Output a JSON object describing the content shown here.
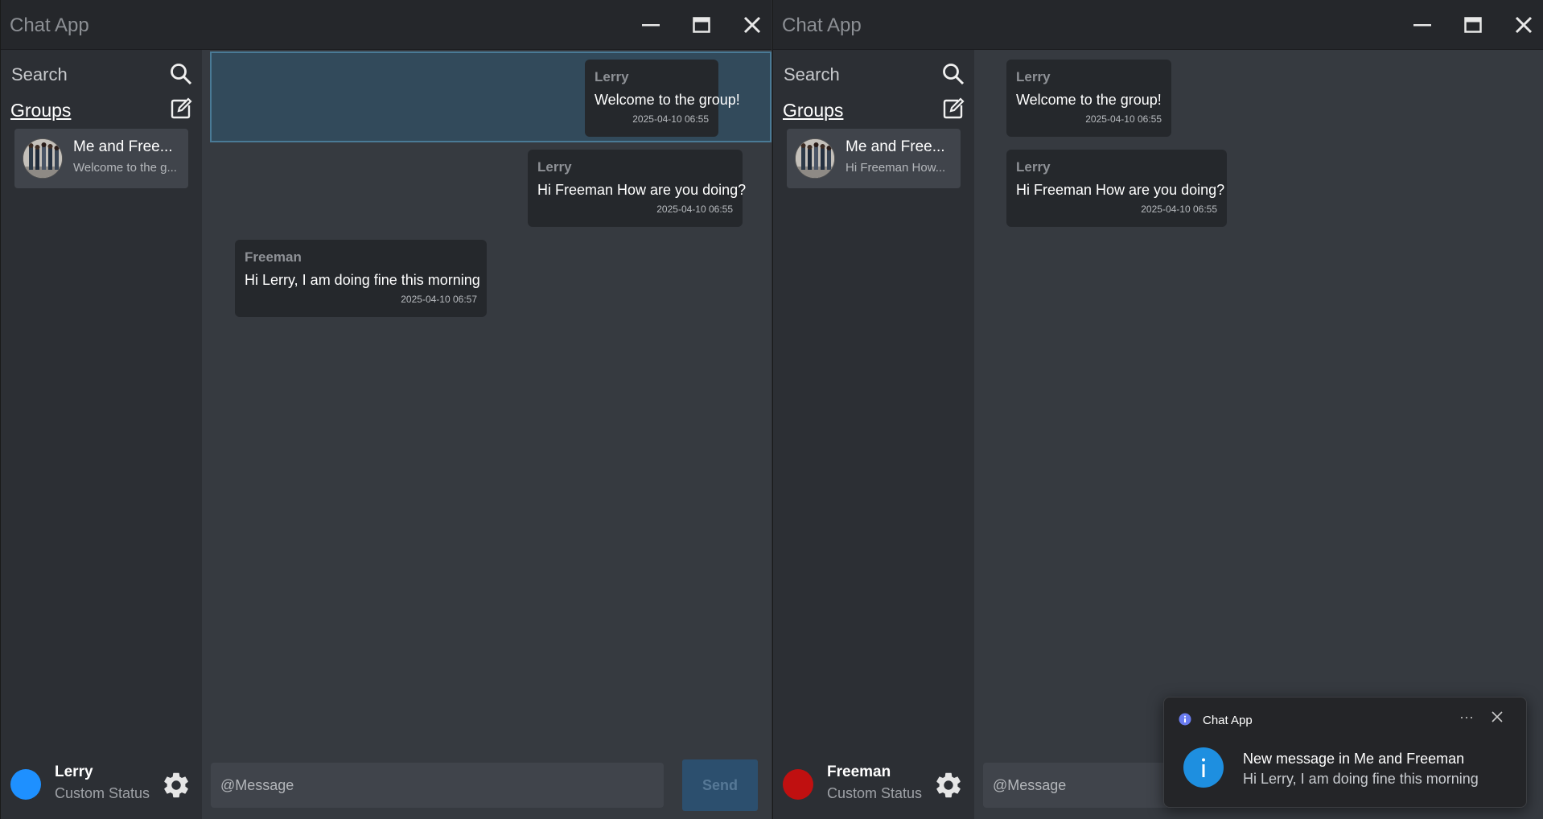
{
  "left_window": {
    "title": "Chat App",
    "sidebar": {
      "search_label": "Search",
      "groups_label": "Groups",
      "group": {
        "name": "Me and Free...",
        "preview": "Welcome to the g..."
      }
    },
    "messages": [
      {
        "sender": "Lerry",
        "text": "Welcome to the group!",
        "time": "2025-04-10 06:55"
      },
      {
        "sender": "Lerry",
        "text": "Hi Freeman How are you doing?",
        "time": "2025-04-10 06:55"
      },
      {
        "sender": "Freeman",
        "text": "Hi Lerry, I am doing fine this morning",
        "time": "2025-04-10 06:57"
      }
    ],
    "user": {
      "name": "Lerry",
      "status": "Custom Status",
      "status_color": "#1e90ff"
    },
    "composer": {
      "placeholder": "@Message",
      "send_label": "Send"
    }
  },
  "right_window": {
    "title": "Chat App",
    "sidebar": {
      "search_label": "Search",
      "groups_label": "Groups",
      "group": {
        "name": "Me and Free...",
        "preview": "Hi Freeman How..."
      }
    },
    "messages": [
      {
        "sender": "Lerry",
        "text": "Welcome to the group!",
        "time": "2025-04-10 06:55"
      },
      {
        "sender": "Lerry",
        "text": "Hi Freeman How are you doing?",
        "time": "2025-04-10 06:55"
      }
    ],
    "user": {
      "name": "Freeman",
      "status": "Custom Status",
      "status_color": "#c01010"
    },
    "composer": {
      "placeholder": "@Message"
    }
  },
  "notification": {
    "app_name": "Chat App",
    "more_label": "···",
    "title": "New message in Me and Freeman",
    "body": "Hi Lerry, I am doing fine this morning"
  }
}
